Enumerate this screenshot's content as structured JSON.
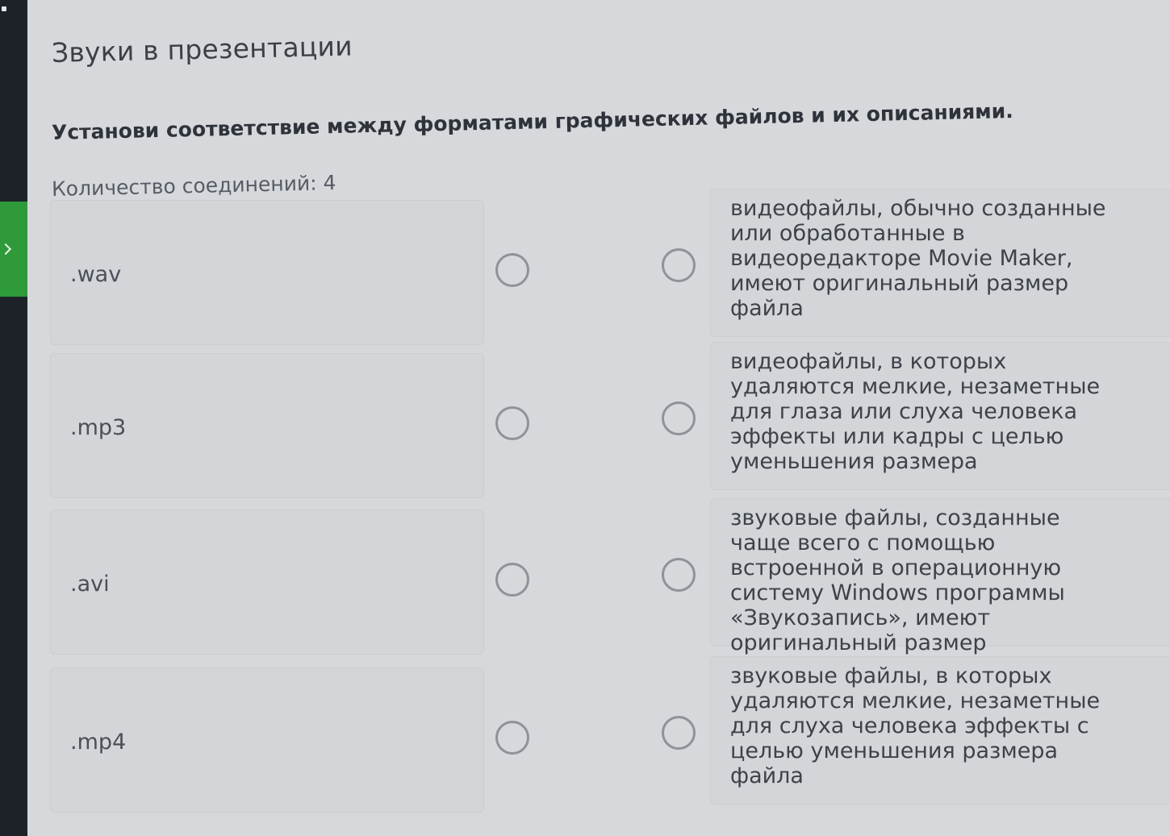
{
  "page": {
    "title": "Звуки в презентации",
    "instruction": "Установи соответствие между форматами графических файлов и их описаниями.",
    "connections_count": "Количество соединений: 4"
  },
  "left_items": [
    {
      "label": ".wav"
    },
    {
      "label": ".mp3"
    },
    {
      "label": ".avi"
    },
    {
      "label": ".mp4"
    }
  ],
  "right_items": [
    {
      "text": "видеофайлы, обычно созданные\nили обработанные в\nвидеоредакторе Movie Maker,\nимеют оригинальный размер\nфайла"
    },
    {
      "text": "видеофайлы, в которых\nудаляются мелкие, незаметные\nдля глаза или слуха человека\nэффекты или кадры с целью\nуменьшения размера"
    },
    {
      "text": "звуковые файлы, созданные\nчаще всего с помощью\nвстроенной в операционную\nсистему Windows программы\n«Звукозапись», имеют\nоригинальный размер"
    },
    {
      "text": "звуковые файлы, в которых\nудаляются мелкие, незаметные\nдля слуха человека эффекты с\nцелью уменьшения размера\nфайла"
    }
  ],
  "colors": {
    "background": "#d6d8db",
    "rail": "#1d2229",
    "rail_accent": "#2f9a3a"
  }
}
